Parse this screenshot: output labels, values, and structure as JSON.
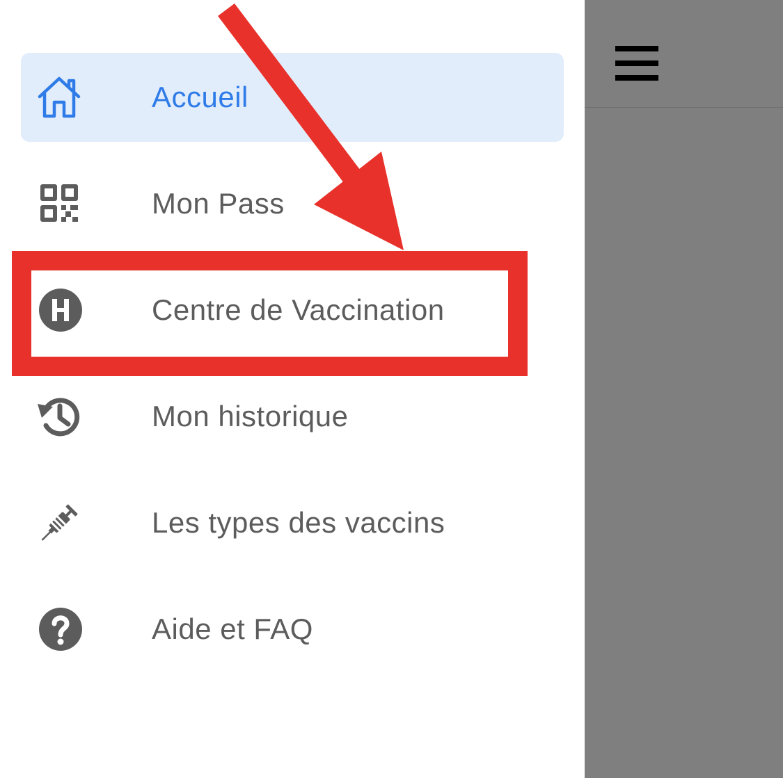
{
  "menu": {
    "items": [
      {
        "label": "Accueil",
        "icon": "home-icon",
        "active": true
      },
      {
        "label": "Mon Pass",
        "icon": "qr-code-icon",
        "active": false
      },
      {
        "label": "Centre de Vaccination",
        "icon": "hospital-icon",
        "active": false
      },
      {
        "label": "Mon historique",
        "icon": "history-icon",
        "active": false
      },
      {
        "label": "Les types des vaccins",
        "icon": "syringe-icon",
        "active": false
      },
      {
        "label": "Aide et FAQ",
        "icon": "help-icon",
        "active": false
      }
    ]
  },
  "header": {
    "menu_icon": "hamburger-menu-icon"
  },
  "annotation": {
    "highlighted_item": "Centre de Vaccination",
    "color": "#e8312a"
  },
  "colors": {
    "active_text": "#2f7ce8",
    "active_background": "#e2edfc",
    "item_text": "#5c5c5c",
    "icon": "#5c5c5c",
    "overlay": "#7f7f7f"
  }
}
